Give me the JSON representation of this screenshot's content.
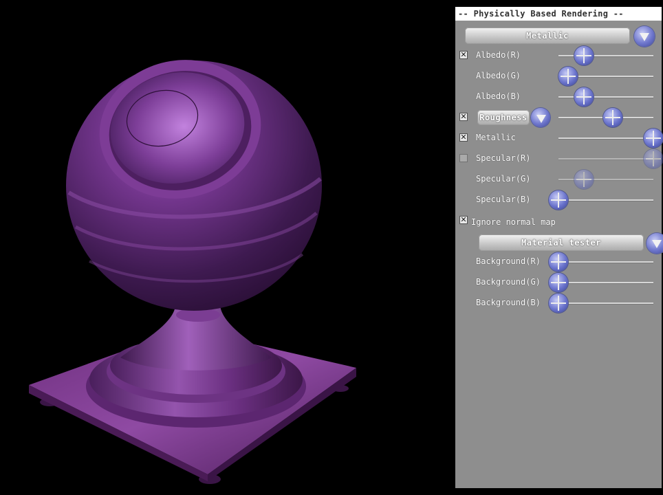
{
  "panel": {
    "title": "-- Physically Based Rendering --",
    "material_dropdown": {
      "selected": "Metallic"
    },
    "rows": [
      {
        "label": "Albedo(R)",
        "checkbox": "checked",
        "value": 0.27
      },
      {
        "label": "Albedo(G)",
        "checkbox": "none",
        "value": 0.1
      },
      {
        "label": "Albedo(B)",
        "checkbox": "none",
        "value": 0.27
      },
      {
        "label": "Roughness",
        "checkbox": "checked",
        "value": 0.57,
        "has_dropdown": true
      },
      {
        "label": "Metallic",
        "checkbox": "checked",
        "value": 1.0
      },
      {
        "label": "Specular(R)",
        "checkbox": "unchecked",
        "value": 1.0,
        "disabled": true
      },
      {
        "label": "Specular(G)",
        "checkbox": "none",
        "value": 0.27,
        "disabled": true
      },
      {
        "label": "Specular(B)",
        "checkbox": "none",
        "value": 0.0
      }
    ],
    "ignore_normal_map": {
      "label": "Ignore normal map",
      "checkbox": "checked"
    },
    "scene_dropdown": {
      "selected": "Material tester"
    },
    "background_rows": [
      {
        "label": "Background(R)",
        "value": 0.0
      },
      {
        "label": "Background(G)",
        "value": 0.0
      },
      {
        "label": "Background(B)",
        "value": 0.0
      }
    ],
    "check_glyph": "✕"
  },
  "viewport": {
    "material_color": "#7b3a91",
    "background_color": "#000000"
  }
}
